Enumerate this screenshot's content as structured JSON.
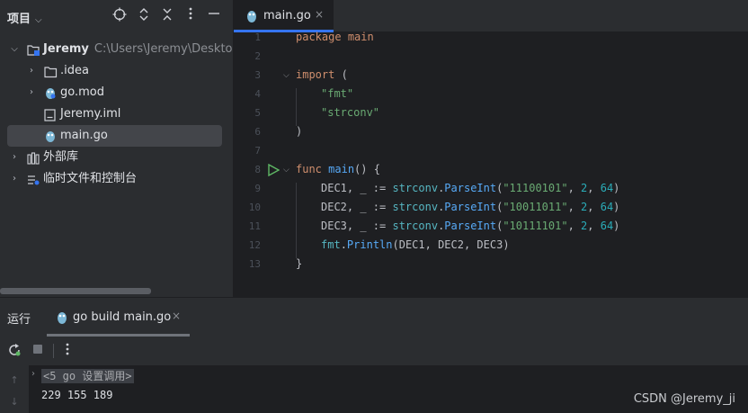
{
  "project_panel": {
    "title": "项目",
    "header_icons": [
      "crosshair-icon",
      "expand-all-icon",
      "collapse-all-icon",
      "more-vertical-icon",
      "minimize-icon"
    ],
    "tree": [
      {
        "label": "Jeremy",
        "path": "C:\\Users\\Jeremy\\Desktop\\G",
        "icon": "module-folder-icon",
        "expanded": true
      },
      {
        "label": ".idea",
        "icon": "folder-icon",
        "expanded": false
      },
      {
        "label": "go.mod",
        "icon": "go-mod-icon",
        "expanded": false
      },
      {
        "label": "Jeremy.iml",
        "icon": "iml-file-icon"
      },
      {
        "label": "main.go",
        "icon": "go-file-icon",
        "selected": true
      },
      {
        "label": "外部库",
        "icon": "library-icon",
        "expanded": false
      },
      {
        "label": "临时文件和控制台",
        "icon": "scratches-icon",
        "expanded": false
      }
    ]
  },
  "editor": {
    "tab": {
      "label": "main.go",
      "close": "×"
    },
    "line_numbers": [
      "1",
      "2",
      "3",
      "4",
      "5",
      "6",
      "7",
      "8",
      "9",
      "10",
      "11",
      "12",
      "13"
    ],
    "code": {
      "l1_kw": "package",
      "l1_name": "main",
      "l3_kw": "import",
      "l3_paren": "(",
      "l4_str": "\"fmt\"",
      "l5_str": "\"strconv\"",
      "l6_paren": ")",
      "l8_kw": "func",
      "l8_fn": "main",
      "l8_rest": "() {",
      "l9_var": "DEC1, _ := ",
      "l9_pkg": "strconv",
      "l9_dot": ".",
      "l9_fn": "ParseInt",
      "l9_open": "(",
      "l9_str": "\"11100101\"",
      "l9_c1": ", ",
      "l9_n1": "2",
      "l9_c2": ", ",
      "l9_n2": "64",
      "l9_close": ")",
      "l10_var": "DEC2, _ := ",
      "l10_pkg": "strconv",
      "l10_dot": ".",
      "l10_fn": "ParseInt",
      "l10_open": "(",
      "l10_str": "\"10011011\"",
      "l10_c1": ", ",
      "l10_n1": "2",
      "l10_c2": ", ",
      "l10_n2": "64",
      "l10_close": ")",
      "l11_var": "DEC3, _ := ",
      "l11_pkg": "strconv",
      "l11_dot": ".",
      "l11_fn": "ParseInt",
      "l11_open": "(",
      "l11_str": "\"10111101\"",
      "l11_c1": ", ",
      "l11_n1": "2",
      "l11_c2": ", ",
      "l11_n2": "64",
      "l11_close": ")",
      "l12_pkg": "fmt",
      "l12_dot": ".",
      "l12_fn": "Println",
      "l12_rest": "(DEC1, DEC2, DEC3)",
      "l13_brace": "}"
    }
  },
  "run_panel": {
    "title": "运行",
    "tab_label": "go build main.go",
    "tab_close": "×",
    "toolbar_icons": [
      "rerun-icon",
      "stop-icon",
      "more-vertical-icon"
    ],
    "console": {
      "setup_line": "<5 go 设置调用>",
      "output_line": "229 155 189"
    }
  },
  "watermark": "CSDN @Jeremy_ji",
  "colors": {
    "accent": "#3574f0",
    "keyword": "#cf8e6d",
    "string": "#6aab73",
    "number": "#2aacb8",
    "function": "#56a8f5",
    "run_green": "#5fb865"
  }
}
